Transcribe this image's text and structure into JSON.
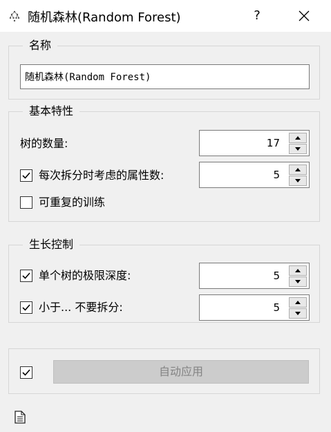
{
  "window": {
    "title": "随机森林(Random Forest)",
    "help_label": "?",
    "icon": "random-forest-icon",
    "close_icon": "close-icon"
  },
  "name_group": {
    "title": "名称",
    "value": "随机森林(Random Forest)"
  },
  "basic_group": {
    "title": "基本特性",
    "n_trees_label": "树的数量:",
    "n_trees_value": "17",
    "max_features_checked": true,
    "max_features_label": "每次拆分时考虑的属性数:",
    "max_features_value": "5",
    "reproducible_checked": false,
    "reproducible_label": "可重复的训练"
  },
  "growth_group": {
    "title": "生长控制",
    "max_depth_checked": true,
    "max_depth_label": "单个树的极限深度:",
    "max_depth_value": "5",
    "min_split_checked": true,
    "min_split_label": "小于... 不要拆分:",
    "min_split_value": "5"
  },
  "apply_group": {
    "auto_apply_checked": true,
    "apply_label": "自动应用"
  },
  "footer": {
    "report_icon": "report-document-icon"
  }
}
